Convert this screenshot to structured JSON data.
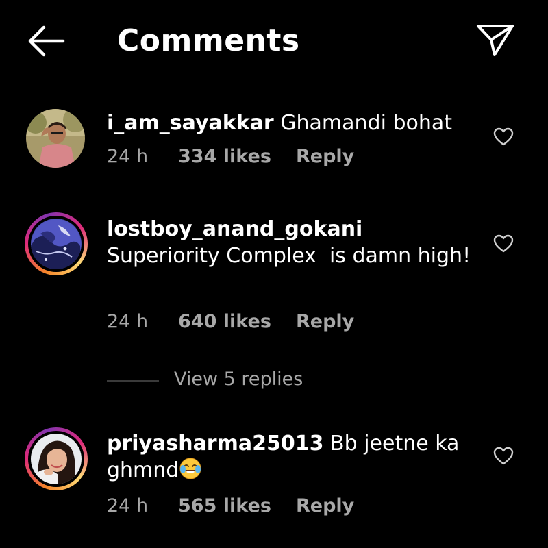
{
  "header": {
    "title": "Comments",
    "back_icon": "arrow-left-icon",
    "share_icon": "paper-plane-icon"
  },
  "comments": [
    {
      "username": "i_am_sayakkar",
      "text": "Ghamandi bohat",
      "time": "24 h",
      "likes": "334 likes",
      "reply": "Reply",
      "story_ring": false
    },
    {
      "username": "lostboy_anand_gokani",
      "text": "Superiority Complex  is damn high!",
      "time": "24 h",
      "likes": "640 likes",
      "reply": "Reply",
      "story_ring": true,
      "view_replies": "View 5 replies"
    },
    {
      "username": "priyasharma25013",
      "text": "Bb jeetne ka ghmnd",
      "emoji": "face-with-tears-of-joy",
      "time": "24 h",
      "likes": "565 likes",
      "reply": "Reply",
      "story_ring": true
    }
  ],
  "colors": {
    "background": "#000000",
    "text": "#ffffff",
    "secondary_text": "#a8a8a8",
    "story_ring_start": "#f58529",
    "story_ring_end": "#dd2a7b"
  }
}
